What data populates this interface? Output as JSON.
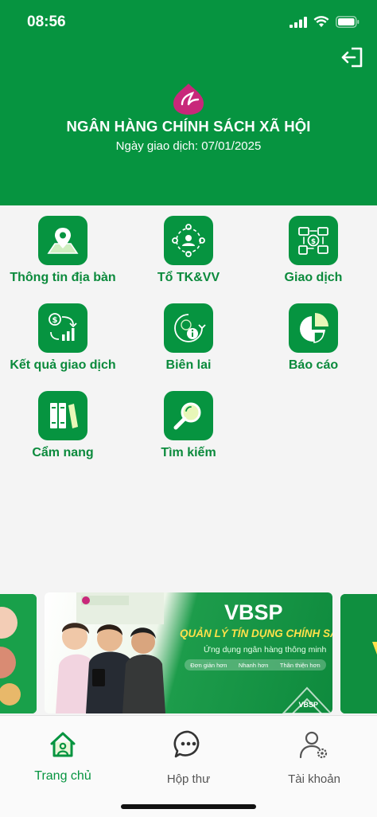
{
  "status": {
    "time": "08:56"
  },
  "header": {
    "bank_name": "NGÂN HÀNG CHÍNH SÁCH XÃ HỘI",
    "trade_date": "Ngày giao dịch: 07/01/2025"
  },
  "menu": {
    "items": [
      {
        "label": "Thông tin địa bàn",
        "icon": "map-pin-icon"
      },
      {
        "label": "Tổ TK&VV",
        "icon": "group-network-icon"
      },
      {
        "label": "Giao dịch",
        "icon": "transaction-icon"
      },
      {
        "label": "Kết quả giao dịch",
        "icon": "growth-chart-icon"
      },
      {
        "label": "Biên lai",
        "icon": "receipt-info-icon"
      },
      {
        "label": "Báo cáo",
        "icon": "pie-chart-icon"
      },
      {
        "label": "Cẩm nang",
        "icon": "books-icon"
      },
      {
        "label": "Tìm kiếm",
        "icon": "search-icon"
      }
    ]
  },
  "banner": {
    "title": "VBSP",
    "subtitle": "QUẢN LÝ TÍN DỤNG CHÍNH SÁCH",
    "tagline": "Ứng dụng ngân hàng thông minh",
    "pills": [
      "Đơn giản hơn",
      "Nhanh hơn",
      "Thân thiện hơn"
    ],
    "mark": "VBSP"
  },
  "tabbar": {
    "home": "Trang chủ",
    "inbox": "Hộp thư",
    "account": "Tài khoản"
  },
  "colors": {
    "primary": "#069440",
    "label": "#0b8a3c"
  }
}
